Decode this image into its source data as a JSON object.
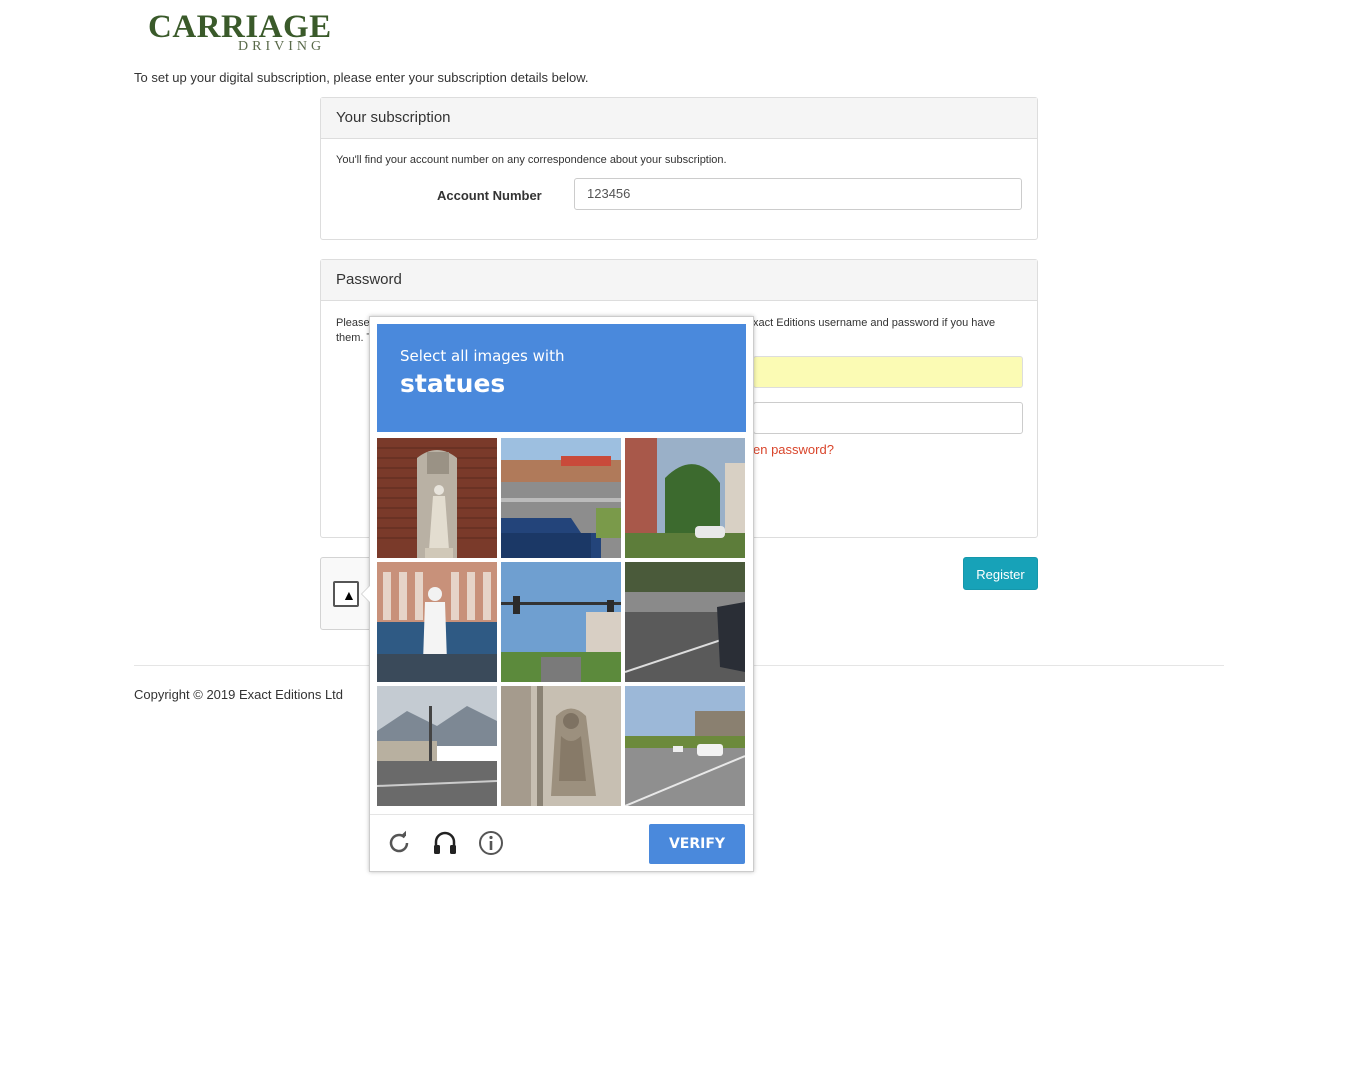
{
  "brand": {
    "name": "CARRIAGE",
    "sub": "DRIVING"
  },
  "intro": "To set up your digital subscription, please enter your subscription details below.",
  "subscription": {
    "title": "Your subscription",
    "hint": "You'll find your account number on any correspondence about your subscription.",
    "account_label": "Account Number",
    "account_value": "123456"
  },
  "password": {
    "title": "Password",
    "text_left": "Please them. T",
    "text_right": "xact Editions username and password if you have",
    "forgot": "en password?"
  },
  "register_label": "Register",
  "copyright": "Copyright © 2019 Exact Editions Ltd",
  "captcha": {
    "prompt": "Select all images with",
    "target": "statues",
    "verify_label": "VERIFY",
    "tiles": [
      "statue-niche",
      "pickup-truck-street",
      "house-street",
      "white-statue-balustrade",
      "traffic-light-street",
      "road-car",
      "intersection-mountains",
      "stone-relief-statue",
      "road-suv"
    ],
    "accent": "#4a89dc"
  }
}
